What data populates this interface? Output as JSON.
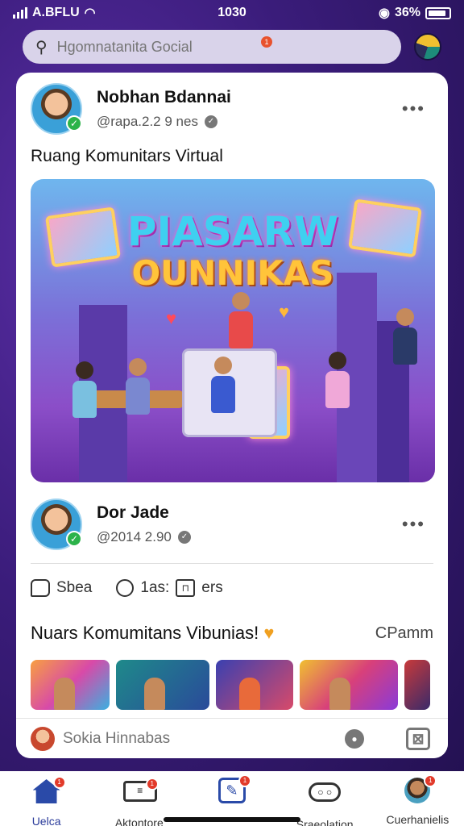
{
  "status_bar": {
    "carrier": "A.BFLU",
    "time": "1030",
    "battery": "36%"
  },
  "search": {
    "placeholder": "Hgomnatanita Gocial",
    "badge": "1"
  },
  "post1": {
    "author": "Nobhan Bdannai",
    "meta": "@rapa.2.2 9 nes",
    "text": "Ruang Komunitars Virtual",
    "image_title_line1": "PIASARW",
    "image_title_line2": "OUNNIKAS"
  },
  "post2": {
    "author": "Dor Jade",
    "meta": "@2014 2.90"
  },
  "actions": {
    "share": "Sbea",
    "comment": "1as:",
    "more": "ers"
  },
  "community": {
    "title": "Nuars Komumitans Vibunias!",
    "heart": "♥",
    "link": "CPamm"
  },
  "comment_bar": {
    "placeholder": "Sokia Hinnabas"
  },
  "nav": {
    "items": [
      {
        "label": "Uelca",
        "badge": "1"
      },
      {
        "label": "Aktontore",
        "badge": "1"
      },
      {
        "label": "",
        "badge": "1"
      },
      {
        "label": "Sraeolation",
        "badge": ""
      },
      {
        "label": "Cuerhanielis",
        "badge": "1"
      }
    ]
  },
  "colors": {
    "background": "#3a1c7a",
    "accent": "#2a4aa8",
    "badge": "#e23a2a",
    "verified": "#2cb34a"
  }
}
